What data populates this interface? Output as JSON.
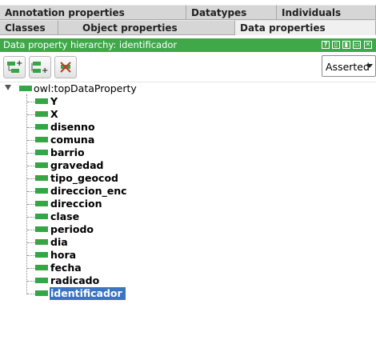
{
  "tabs_top": [
    {
      "label": "Annotation properties",
      "active": false
    },
    {
      "label": "Datatypes",
      "active": false
    },
    {
      "label": "Individuals",
      "active": false
    }
  ],
  "tabs_bottom": [
    {
      "label": "Classes",
      "active": false
    },
    {
      "label": "Object properties",
      "active": false
    },
    {
      "label": "Data properties",
      "active": true
    }
  ],
  "panel": {
    "title": "Data property hierarchy: identificador",
    "header_buttons": [
      "?",
      "▯",
      "▮",
      "▭",
      "✕"
    ]
  },
  "toolbar": {
    "buttons": [
      "add-sub-property-icon",
      "add-sibling-property-icon",
      "delete-property-icon"
    ],
    "view_mode": "Asserted"
  },
  "tree": {
    "root": "owl:topDataProperty",
    "children": [
      "Y",
      "X",
      "disenno",
      "comuna",
      "barrio",
      "gravedad",
      "tipo_geocod",
      "direccion_enc",
      "direccion",
      "clase",
      "periodo",
      "dia",
      "hora",
      "fecha",
      "radicado",
      "identificador"
    ],
    "selected": "identificador"
  },
  "colors": {
    "header_green": "#3fa94a",
    "property_green": "#35a545",
    "selection_blue": "#3a75c4"
  }
}
